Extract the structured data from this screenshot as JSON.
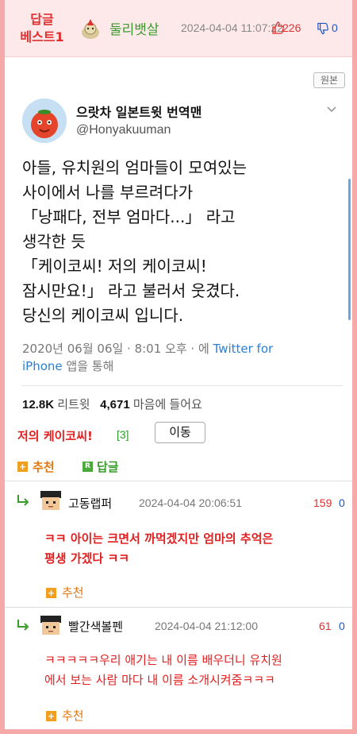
{
  "header": {
    "best_label_line1": "답글",
    "best_label_line2": "베스트1",
    "author": "둘리뱃살",
    "date": "2024-04-04 11:07:22",
    "likes": "226",
    "dislikes": "0"
  },
  "original_button": "원본",
  "tweet": {
    "name": "으랏차 일본트윗 번역맨",
    "handle": "@Honyakuuman",
    "lines": [
      "아들, 유치원의 엄마들이 모여있는",
      "사이에서 나를 부르려다가",
      "「낭패다, 전부 엄마다...」 라고",
      "생각한 듯",
      "「케이코씨! 저의 케이코씨!",
      "잠시만요!」 라고 불러서 웃겼다.",
      "당신의 케이코씨 입니다."
    ],
    "meta_prefix": "2020년 06월 06일 · 8:01 오후 · 에 ",
    "meta_link_1": "Twitter for",
    "meta_link_2": "iPhone",
    "meta_suffix": " 앱을 통해",
    "retweets": "12.8K",
    "retweets_label": "리트윗",
    "likes": "4,671",
    "likes_label": "마음에 들어요"
  },
  "post": {
    "title": "저의 케이코씨!",
    "comment_count": "[3]",
    "move_button": "이동",
    "recommend_label": "추천",
    "reply_label": "답글",
    "recommend_icon": "+",
    "reply_icon": "R"
  },
  "comments": [
    {
      "author": "고동랩퍼",
      "date": "2024-04-04 20:06:51",
      "likes": "159",
      "dislikes": "0",
      "lines": [
        "ㅋㅋ 아이는 크면서 까먹겠지만 엄마의 추억은",
        "평생 가겠다 ㅋㅋ"
      ],
      "recommend_label": "추천"
    },
    {
      "author": "빨간색볼펜",
      "date": "2024-04-04 21:12:00",
      "likes": "61",
      "dislikes": "0",
      "lines": [
        "ㅋㅋㅋㅋㅋ우리 애기는 내 이름 배우더니 유치원",
        "에서 보는 사람 마다 내 이름 소개시켜줌ㅋㅋㅋ"
      ],
      "recommend_label": "추천"
    }
  ],
  "colors": {
    "accent_red": "#e02020",
    "author_green": "#3b9a2e",
    "link_blue": "#2a7fd4",
    "frame_pink": "#f6a9a9"
  }
}
